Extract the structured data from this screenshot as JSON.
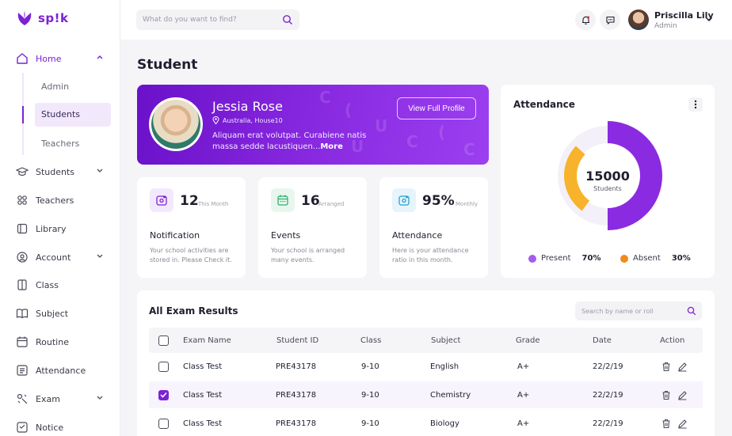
{
  "brand": {
    "name": "sp!k",
    "accent": "#7b22d4"
  },
  "sidebar": {
    "home": "Home",
    "sub": [
      "Admin",
      "Students",
      "Teachers"
    ],
    "items": [
      {
        "label": "Students",
        "icon": "graduation-cap-icon",
        "has_chevron": true
      },
      {
        "label": "Teachers",
        "icon": "people-icon",
        "has_chevron": false
      },
      {
        "label": "Library",
        "icon": "book-icon",
        "has_chevron": false
      },
      {
        "label": "Account",
        "icon": "user-icon",
        "has_chevron": true
      },
      {
        "label": "Class",
        "icon": "class-icon",
        "has_chevron": false
      },
      {
        "label": "Subject",
        "icon": "open-book-icon",
        "has_chevron": false
      },
      {
        "label": "Routine",
        "icon": "calendar-icon",
        "has_chevron": false
      },
      {
        "label": "Attendance",
        "icon": "list-icon",
        "has_chevron": false
      },
      {
        "label": "Exam",
        "icon": "exam-icon",
        "has_chevron": true
      },
      {
        "label": "Notice",
        "icon": "notice-icon",
        "has_chevron": false
      }
    ]
  },
  "topbar": {
    "search_placeholder": "What do you want to find?",
    "user_name": "Priscilla Lily",
    "user_role": "Admin"
  },
  "page": {
    "title": "Student"
  },
  "profile": {
    "name": "Jessia Rose",
    "location": "Australia, House10",
    "description": "Aliquam erat volutpat. Curabiene natis massa sedde lacustiquen...",
    "more": "More",
    "button": "View Full Profile"
  },
  "stats": [
    {
      "value": "12",
      "unit": "This Month",
      "title": "Notification",
      "desc": "Your school activities are stored in. Please Check it.",
      "color": "#7b22d4",
      "bg": "#f3e9fc",
      "icon": "notification-icon"
    },
    {
      "value": "16",
      "unit": "Arranged",
      "title": "Events",
      "desc": "Your school is arranged many events.",
      "color": "#2fae6a",
      "bg": "#e8f7ee",
      "icon": "calendar-icon"
    },
    {
      "value": "95%",
      "unit": "Monthly",
      "title": "Attendance",
      "desc": "Here is your attendance ratio in this month.",
      "color": "#2a9fd0",
      "bg": "#e6f4fb",
      "icon": "attendance-icon"
    }
  ],
  "attendance": {
    "title": "Attendance",
    "total": "15000",
    "total_label": "Students",
    "present_label": "Present",
    "present_pct": "70%",
    "absent_label": "Absent",
    "absent_pct": "30%",
    "present_fraction": 0.7,
    "absent_fraction": 0.3,
    "present_color": "#8a2be2",
    "absent_color": "#f7b32b"
  },
  "results": {
    "title": "All Exam Results",
    "search_placeholder": "Search by name or roll",
    "columns": [
      "Exam Name",
      "Student ID",
      "Class",
      "Subject",
      "Grade",
      "Date",
      "Action"
    ],
    "rows": [
      {
        "exam": "Class Test",
        "id": "PRE43178",
        "class": "9-10",
        "subject": "English",
        "grade": "A+",
        "date": "22/2/19",
        "checked": false
      },
      {
        "exam": "Class Test",
        "id": "PRE43178",
        "class": "9-10",
        "subject": "Chemistry",
        "grade": "A+",
        "date": "22/2/19",
        "checked": true
      },
      {
        "exam": "Class Test",
        "id": "PRE43178",
        "class": "9-10",
        "subject": "Biology",
        "grade": "A+",
        "date": "22/2/19",
        "checked": false
      }
    ]
  }
}
